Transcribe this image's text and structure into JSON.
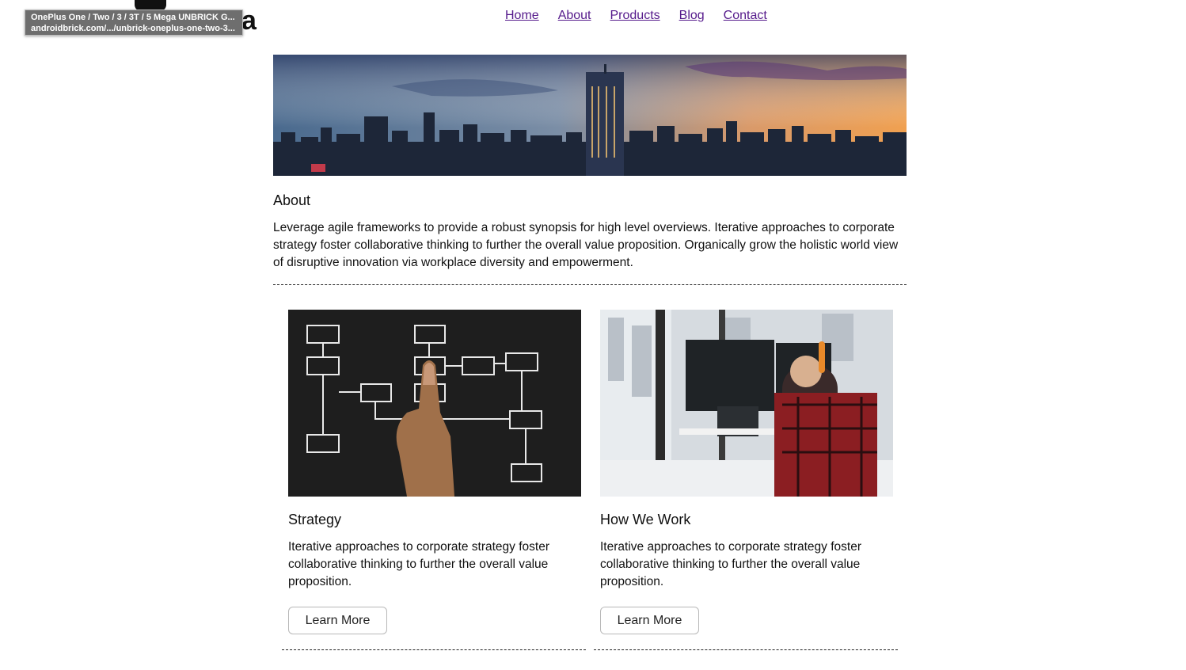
{
  "tooltip": {
    "title": "OnePlus One / Two / 3 / 3T / 5 Mega UNBRICK G...",
    "url": "androidbrick.com/.../unbrick-oneplus-one-two-3..."
  },
  "logo": {
    "visible_letter": "a"
  },
  "nav": {
    "items": [
      {
        "label": "Home"
      },
      {
        "label": "About"
      },
      {
        "label": "Products"
      },
      {
        "label": "Blog"
      },
      {
        "label": "Contact"
      }
    ]
  },
  "about": {
    "title": "About",
    "body": "Leverage agile frameworks to provide a robust synopsis for high level overviews. Iterative approaches to corporate strategy foster collaborative thinking to further the overall value proposition. Organically grow the holistic world view of disruptive innovation via workplace diversity and empowerment."
  },
  "cards": [
    {
      "title": "Strategy",
      "body": "Iterative approaches to corporate strategy foster collaborative thinking to further the overall value proposition.",
      "button": "Learn More"
    },
    {
      "title": "How We Work",
      "body": "Iterative approaches to corporate strategy foster collaborative thinking to further the overall value proposition.",
      "button": "Learn More"
    }
  ],
  "colors": {
    "link": "#551a8b",
    "text": "#111111",
    "button_border": "#b8b8b8"
  }
}
